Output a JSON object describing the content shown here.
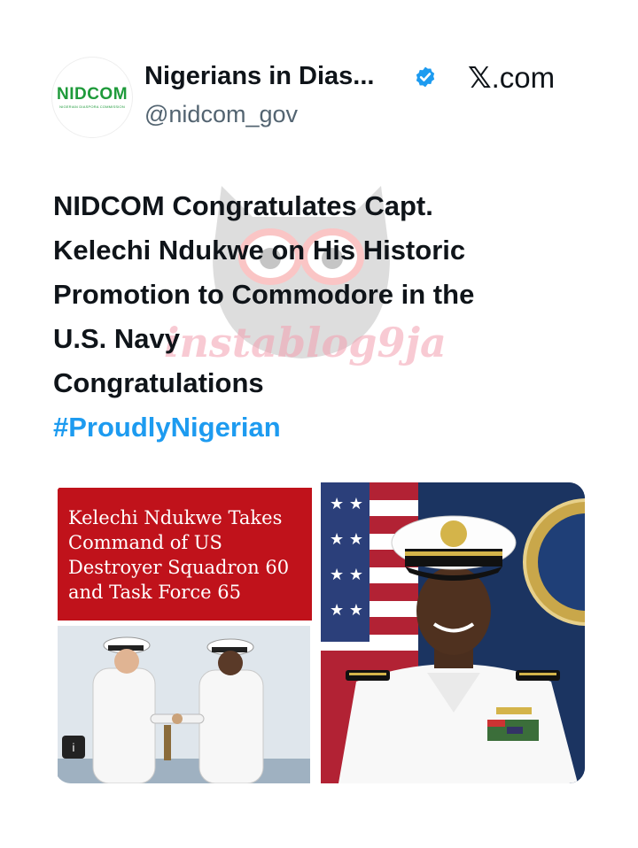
{
  "account": {
    "display_name": "Nigerians in Dias...",
    "handle": "@nidcom_gov",
    "logo_text": "NIDCOM",
    "logo_subtext": "NIGERIAN DIASPORA COMMISSION",
    "verified_icon": "verified-badge-icon"
  },
  "source": {
    "label": ".com",
    "logo_letter": "𝕏"
  },
  "watermark": {
    "text": "instablog9ja"
  },
  "tweet": {
    "lines": [
      "NIDCOM Congratulates Capt.",
      "Kelechi Ndukwe on His Historic",
      "Promotion to Commodore in the",
      "U.S. Navy",
      "Congratulations"
    ],
    "hashtag": "#ProudlyNigerian"
  },
  "media": {
    "banner_lines": [
      "Kelechi Ndukwe Takes",
      "Command of US",
      "Destroyer Squadron 60",
      "and Task Force 65"
    ],
    "video_badge": "i"
  },
  "colors": {
    "hashtag": "#1d9bf0",
    "verified": "#1d9bf0",
    "banner": "#c0121b",
    "logo_green": "#1e9a3a"
  }
}
